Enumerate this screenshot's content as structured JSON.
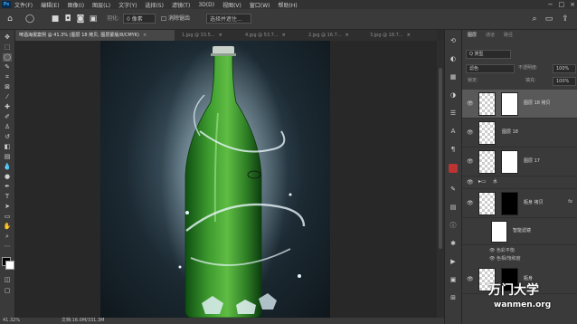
{
  "app": {
    "logo": "Ps"
  },
  "menu": [
    "文件(F)",
    "编辑(E)",
    "图像(I)",
    "图层(L)",
    "文字(Y)",
    "选择(S)",
    "滤镜(T)",
    "3D(D)",
    "视图(V)",
    "窗口(W)",
    "帮助(H)"
  ],
  "window_controls": [
    "−",
    "□",
    "×"
  ],
  "options": {
    "feather_label": "羽化:",
    "feather_value": "0 像素",
    "antialias_label": "消除锯齿",
    "select_mask_button": "选择并遮住..."
  },
  "tabs": [
    {
      "label": "啤酒海报案例 @ 41.3% (图层 18 拷贝, 图层蒙版/8/CMYK)",
      "active": true
    },
    {
      "label": "1.jpg @ 33.5...",
      "active": false
    },
    {
      "label": "4.jpg @ 53.7...",
      "active": false
    },
    {
      "label": "2.jpg @ 16.7...",
      "active": false
    },
    {
      "label": "3.jpg @ 18.7...",
      "active": false
    }
  ],
  "status": {
    "zoom": "41.32%",
    "doc_size": "文档:16.0M/331.3M"
  },
  "layers_panel": {
    "tabs": [
      "图层",
      "通道",
      "路径"
    ],
    "filter_label": "Q 类型",
    "blend_mode": "滤色",
    "opacity_label": "不透明度:",
    "opacity_value": "100%",
    "lock_label": "锁定:",
    "fill_label": "填充:",
    "fill_value": "100%",
    "layers": [
      {
        "name": "图层 18 拷贝",
        "selected": true,
        "has_mask": true
      },
      {
        "name": "图层 18",
        "selected": false,
        "has_mask": false
      },
      {
        "name": "图层 17",
        "selected": false,
        "has_mask": true
      },
      {
        "name": "水",
        "selected": false,
        "is_group": true
      },
      {
        "name": "瓶身 拷贝",
        "selected": false,
        "has_mask": true,
        "fx": true
      },
      {
        "name": "智能滤镜",
        "selected": false,
        "is_filter": true
      },
      {
        "name": "色彩平衡",
        "selected": false,
        "is_fx_item": true
      },
      {
        "name": "色相/饱和度",
        "selected": false,
        "is_fx_item": true
      },
      {
        "name": "瓶身",
        "selected": false,
        "has_mask": true
      }
    ]
  },
  "watermark": {
    "line1": "万门大学",
    "line2": "wanmen.org"
  },
  "colors": {
    "accent": "#31a8ff",
    "selected_row": "#595959",
    "bottle_green": "#2f8a2a"
  }
}
